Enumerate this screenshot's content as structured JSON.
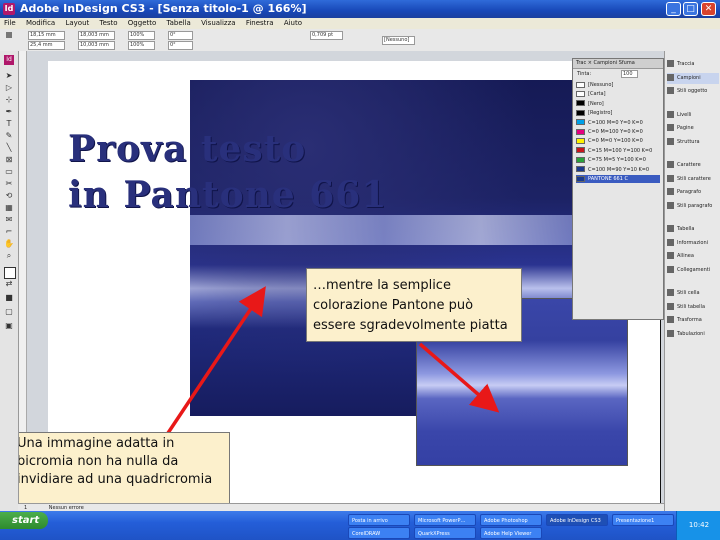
{
  "window": {
    "title": "Adobe InDesign CS3 - [Senza titolo-1 @ 166%]",
    "app_icon_label": "Id",
    "minimize": "_",
    "maximize": "□",
    "close": "✕"
  },
  "menu": [
    "File",
    "Modifica",
    "Layout",
    "Testo",
    "Oggetto",
    "Tabella",
    "Visualizza",
    "Finestra",
    "Aiuto"
  ],
  "control_bar": {
    "x_value": "18,15 mm",
    "y_value": "25,4 mm",
    "w_value": "18,003 mm",
    "h_value": "10,003 mm",
    "scale_x": "100%",
    "scale_y": "100%",
    "rotation": "0°",
    "shear": "0°",
    "stroke": "0,709 pt",
    "zoom_field": "[Nessuno]"
  },
  "document": {
    "heading_line1": "Prova testo",
    "heading_line2": "in Pantone 661"
  },
  "callouts": {
    "right": "…mentre la semplice colorazione Pantone può essere sgradevolmente piatta",
    "left": "Una immagine adatta in bicromia non ha nulla da invidiare ad una quadricromia"
  },
  "swatches_panel": {
    "tabs": "Trac  × Campioni  Sfuma",
    "tint_label": "Tinta:",
    "tint_value": "100",
    "items": [
      {
        "name": "[Nessuno]",
        "color": "#ffffff"
      },
      {
        "name": "[Carta]",
        "color": "#ffffff"
      },
      {
        "name": "[Nero]",
        "color": "#000000"
      },
      {
        "name": "[Registro]",
        "color": "#000000"
      },
      {
        "name": "C=100 M=0 Y=0 K=0",
        "color": "#00a0e8"
      },
      {
        "name": "C=0 M=100 Y=0 K=0",
        "color": "#e4007f"
      },
      {
        "name": "C=0 M=0 Y=100 K=0",
        "color": "#fff100"
      },
      {
        "name": "C=15 M=100 Y=100 K=0",
        "color": "#c8161d"
      },
      {
        "name": "C=75 M=5 Y=100 K=0",
        "color": "#2aa13b"
      },
      {
        "name": "C=100 M=90 Y=10 K=0",
        "color": "#1c3a8c"
      },
      {
        "name": "PANTONE 661 C",
        "color": "#1a3b8f"
      }
    ]
  },
  "right_dock": {
    "items": [
      "Traccia",
      "Campioni",
      "Stili oggetto",
      "Livelli",
      "Pagine",
      "Struttura",
      "Carattere",
      "Stili carattere",
      "Paragrafo",
      "Stili paragrafo",
      "Tabella",
      "Informazioni",
      "Allinea",
      "Collegamenti",
      "Stili cella",
      "Stili tabella",
      "Trasforma",
      "Tabulazioni"
    ]
  },
  "status_bar": {
    "page": "1",
    "status": "Nessun errore"
  },
  "taskbar": {
    "start_label": "start",
    "tasks": [
      "Posta in arrivo",
      "Microsoft PowerP…",
      "Adobe Photoshop",
      "Adobe InDesign CS3",
      "Presentazione1"
    ],
    "tasks_row2": [
      "CorelDRAW",
      "QuarkXPress",
      "Adobe Help Viewer"
    ],
    "clock": "10:42"
  }
}
